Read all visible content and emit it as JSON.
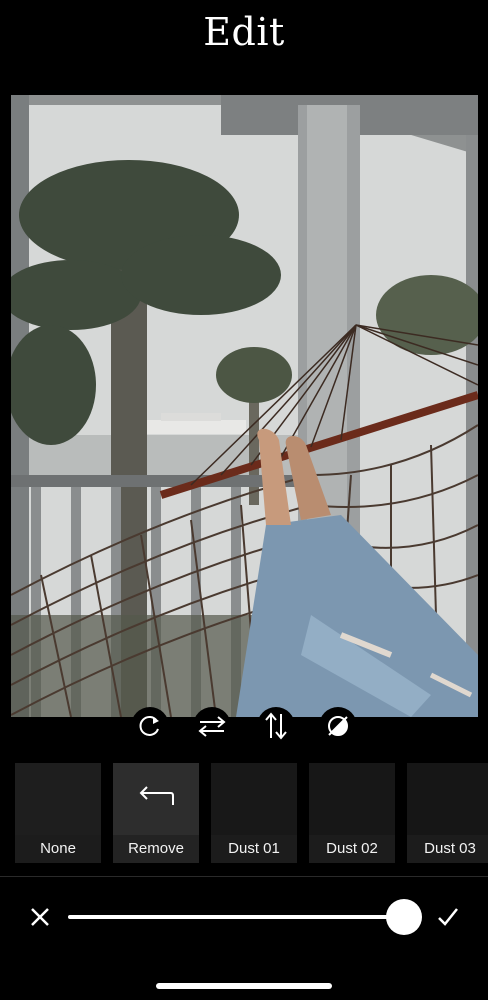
{
  "header": {
    "title": "Edit"
  },
  "photo": {
    "description_icon": "photo-preview"
  },
  "tools": [
    {
      "name": "rotate",
      "icon": "rotate-icon"
    },
    {
      "name": "flip-horizontal",
      "icon": "flip-horizontal-icon"
    },
    {
      "name": "flip-vertical",
      "icon": "flip-vertical-icon"
    },
    {
      "name": "invert",
      "icon": "invert-icon"
    }
  ],
  "presets": [
    {
      "label": "None",
      "selected": false
    },
    {
      "label": "Remove",
      "selected": true,
      "icon": "undo-arrow-icon"
    },
    {
      "label": "Dust 01",
      "selected": false
    },
    {
      "label": "Dust 02",
      "selected": false
    },
    {
      "label": "Dust 03",
      "selected": false
    }
  ],
  "slider": {
    "value": 1.0
  },
  "colors": {
    "background": "#000000",
    "accent": "#ffffff",
    "tile": "#1c1c1c"
  }
}
